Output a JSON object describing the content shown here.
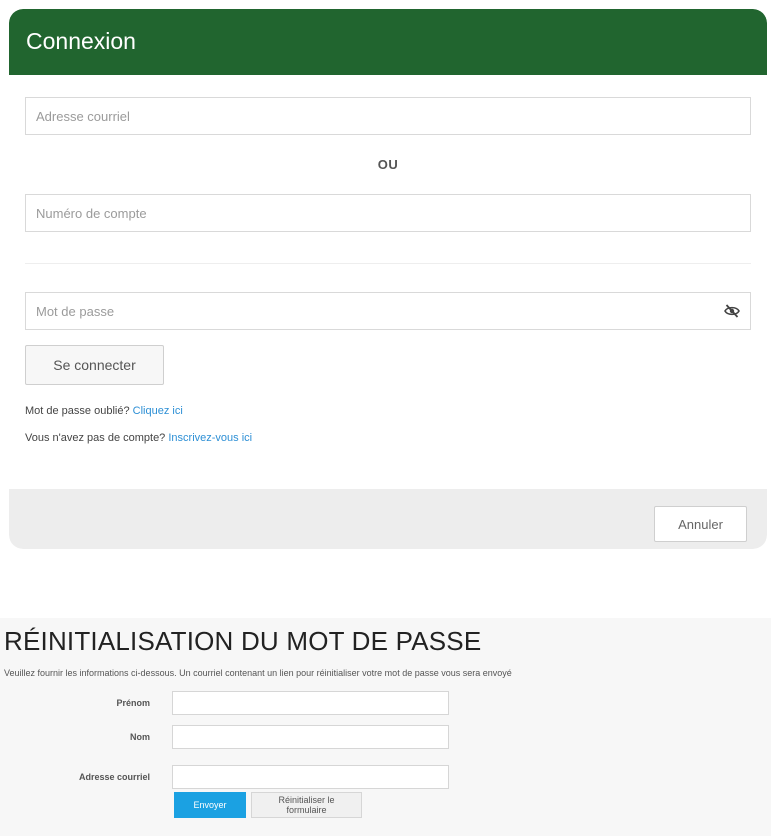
{
  "login": {
    "title": "Connexion",
    "email_placeholder": "Adresse courriel",
    "or_text": "OU",
    "account_placeholder": "Numéro de compte",
    "password_placeholder": "Mot de passe",
    "toggle_password_icon": "eye-slash-icon",
    "submit_label": "Se connecter",
    "forgot_text": "Mot de passe oublié?",
    "forgot_link": "Cliquez ici",
    "register_text": "Vous n'avez pas de compte?",
    "register_link": "Inscrivez-vous ici",
    "cancel_label": "Annuler",
    "header_color": "#21652f",
    "link_color": "#2d8fd5"
  },
  "reset": {
    "title": "RÉINITIALISATION DU MOT DE PASSE",
    "description": "Veuillez fournir les informations ci-dessous. Un courriel contenant un lien pour réinitialiser votre mot de passe vous sera envoyé",
    "first_name_label": "Prénom",
    "last_name_label": "Nom",
    "email_label": "Adresse courriel",
    "first_name_value": "",
    "last_name_value": "",
    "email_value": "",
    "submit_label": "Envoyer",
    "reset_label": "Réinitialiser le formulaire",
    "submit_color": "#1ba1e2"
  }
}
